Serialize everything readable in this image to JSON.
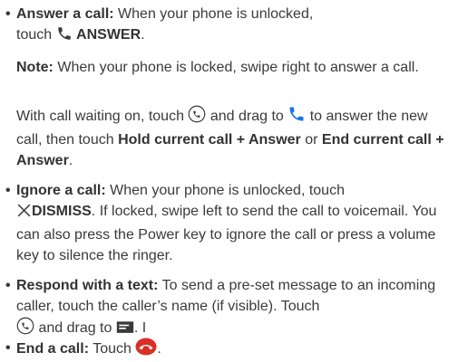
{
  "items": [
    {
      "bullet": "•",
      "title": "Answer a call:",
      "text1": " When your phone is unlocked,",
      "text2": "touch ",
      "button": "ANSWER",
      "end": "."
    },
    {
      "note_title": "Note:",
      "note_text": " When your phone is locked, swipe right to answer a call."
    },
    {
      "text_a": "With call waiting on, touch ",
      "text_b": " and drag to ",
      "text_c": " to answer the new call, then touch ",
      "bold1": "Hold current call + Answer",
      "text_d": " or ",
      "bold2": "End current call + Answer",
      "end": "."
    },
    {
      "bullet": "•",
      "title": "Ignore a call:",
      "text1": " When your phone is unlocked, touch",
      "button": "DISMISS",
      "text2": ". If locked, swipe left to send the call to voicemail. You can also press the Power key to ignore the call or press a volume key to silence the ringer."
    },
    {
      "bullet": "•",
      "title": "Respond with a text:",
      "text1": " To send a pre-set message to an incoming caller, touch the caller’s name (if visible). Touch",
      "text2": " and drag to ",
      "text3": ". I"
    },
    {
      "bullet": "•",
      "title": "End a call:",
      "text1": " Touch ",
      "end": "."
    }
  ],
  "colors": {
    "accent_blue": "#1a73e8",
    "end_red": "#d93025",
    "text": "#3a3a3a"
  },
  "icons": [
    "phone-icon",
    "call-circle-icon",
    "close-x-icon",
    "message-icon",
    "end-call-icon"
  ]
}
